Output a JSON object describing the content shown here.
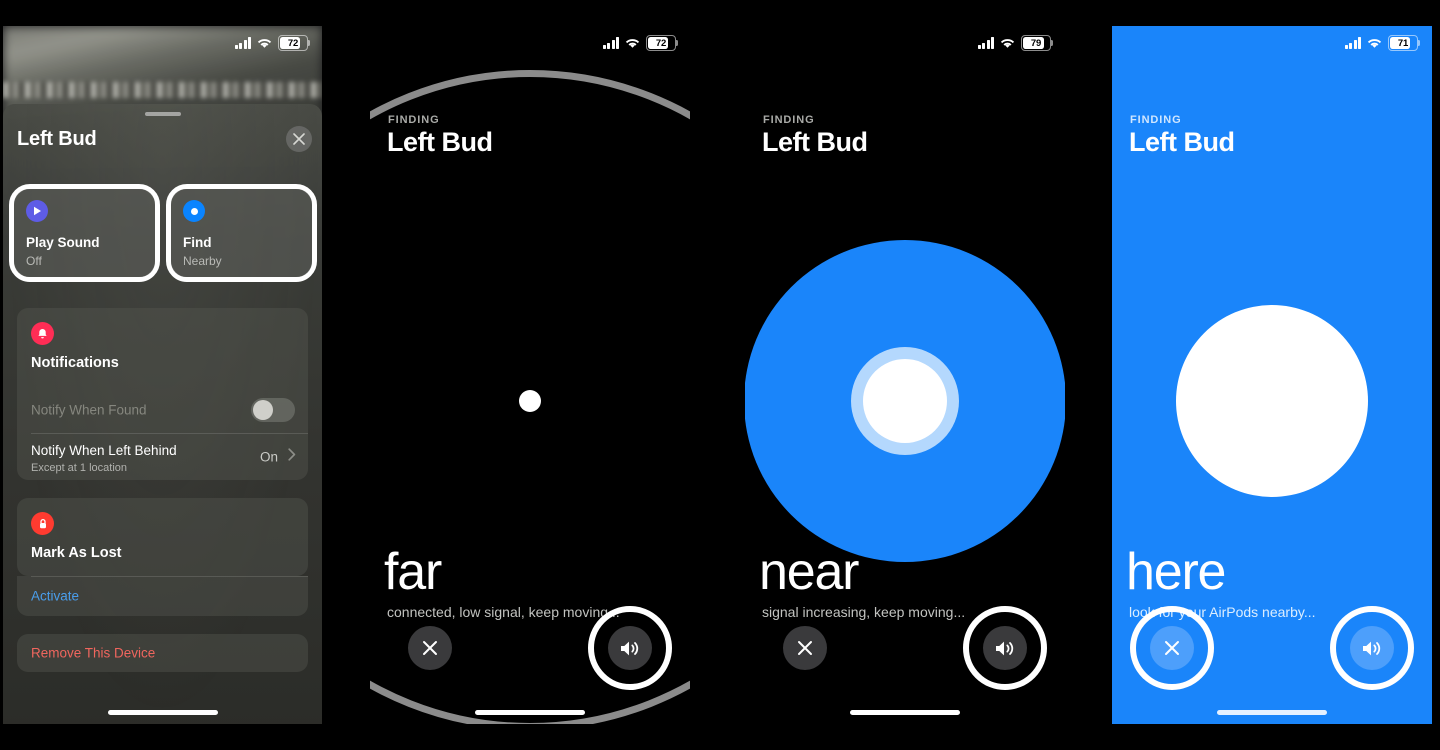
{
  "panel1": {
    "status": {
      "battery": "72",
      "signal_icon": "cellular-bars-icon",
      "wifi_icon": "wifi-icon",
      "battery_icon": "battery-icon"
    },
    "title": "Left Bud",
    "close_label": "close-icon",
    "cards": [
      {
        "label": "Play Sound",
        "sub": "Off",
        "icon": "play-sound-icon",
        "accent": "#5e5ce6"
      },
      {
        "label": "Find",
        "sub": "Nearby",
        "icon": "find-dot-icon",
        "accent": "#0a84ff"
      }
    ],
    "notifications": {
      "title": "Notifications",
      "icon": "bell-icon",
      "icon_color": "#ff2d55",
      "rows": [
        {
          "label": "Notify When Found",
          "control": "toggle",
          "value": "Off"
        },
        {
          "label": "Notify When Left Behind",
          "sub": "Except at 1 location",
          "value": "On",
          "control": "disclosure"
        }
      ]
    },
    "mark_as_lost": {
      "title": "Mark As Lost",
      "icon": "lock-icon",
      "icon_color": "#ff3b30",
      "action": "Activate"
    },
    "remove": {
      "label": "Remove This Device",
      "color": "#f0665e"
    }
  },
  "panel2": {
    "status": {
      "battery": "72"
    },
    "eyebrow": "FINDING",
    "name": "Left Bud",
    "state": "far",
    "hint": "connected, low signal, keep moving...",
    "close_btn": "close-icon",
    "speaker_btn": "speaker-icon",
    "highlight": "speaker"
  },
  "panel3": {
    "status": {
      "battery": "79"
    },
    "eyebrow": "FINDING",
    "name": "Left Bud",
    "state": "near",
    "hint": "signal increasing, keep moving...",
    "close_btn": "close-icon",
    "speaker_btn": "speaker-icon",
    "highlight": "speaker"
  },
  "panel4": {
    "status": {
      "battery": "71"
    },
    "eyebrow": "FINDING",
    "name": "Left Bud",
    "state": "here",
    "hint": "look for your AirPods nearby...",
    "close_btn": "close-icon",
    "speaker_btn": "speaker-icon",
    "highlight": "both",
    "background": "#1a85fa"
  }
}
